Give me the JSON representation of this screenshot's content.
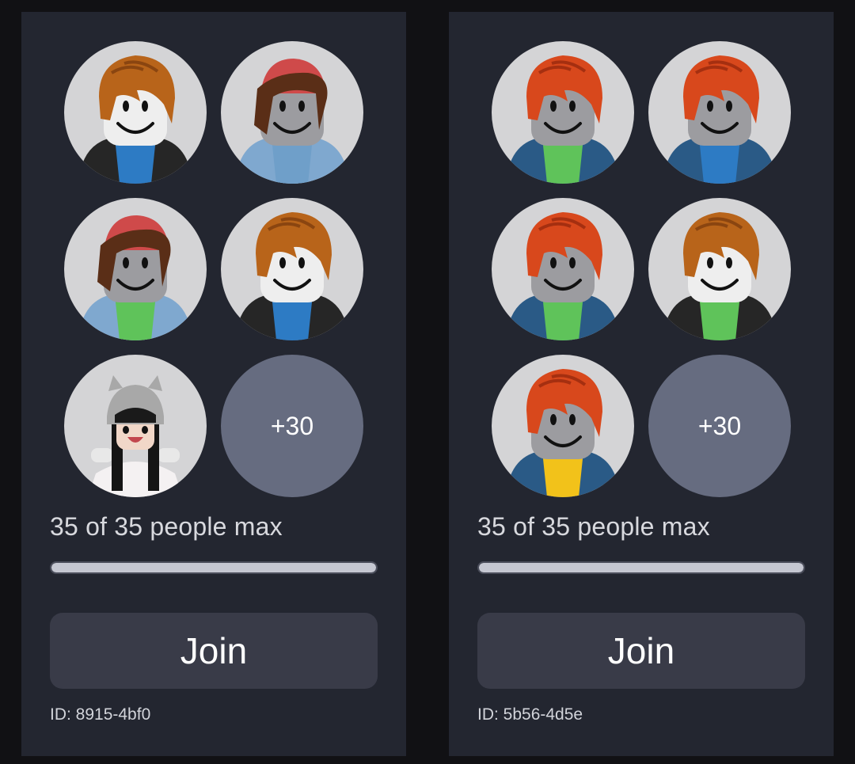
{
  "colors": {
    "background": "#111114",
    "card": "#232630",
    "avatar_bg": "#d4d4d6",
    "more_badge": "#666c80",
    "button": "#393b48",
    "progress_track": "#393c49",
    "progress_fill": "#c5c7d1"
  },
  "servers": [
    {
      "avatars": [
        {
          "icon": "avatar-brown-hair-blue-shirt"
        },
        {
          "icon": "avatar-red-cap-brown-hair-sweater"
        },
        {
          "icon": "avatar-red-cap-brown-hair-green-shirt"
        },
        {
          "icon": "avatar-brown-hair-blue-shirt"
        },
        {
          "icon": "avatar-cat-hat-black-hair"
        }
      ],
      "more_label": "+30",
      "capacity_text": "35 of 35 people max",
      "fill_fraction": 1.0,
      "join_label": "Join",
      "id_text": "ID: 8915-4bf0"
    },
    {
      "avatars": [
        {
          "icon": "avatar-red-hair-green-shirt"
        },
        {
          "icon": "avatar-red-hair-blue-shirt"
        },
        {
          "icon": "avatar-red-hair-green-shirt"
        },
        {
          "icon": "avatar-brown-hair-green-shirt"
        },
        {
          "icon": "avatar-red-hair-yellow-shirt"
        }
      ],
      "more_label": "+30",
      "capacity_text": "35 of 35 people max",
      "fill_fraction": 1.0,
      "join_label": "Join",
      "id_text": "ID: 5b56-4d5e"
    }
  ]
}
